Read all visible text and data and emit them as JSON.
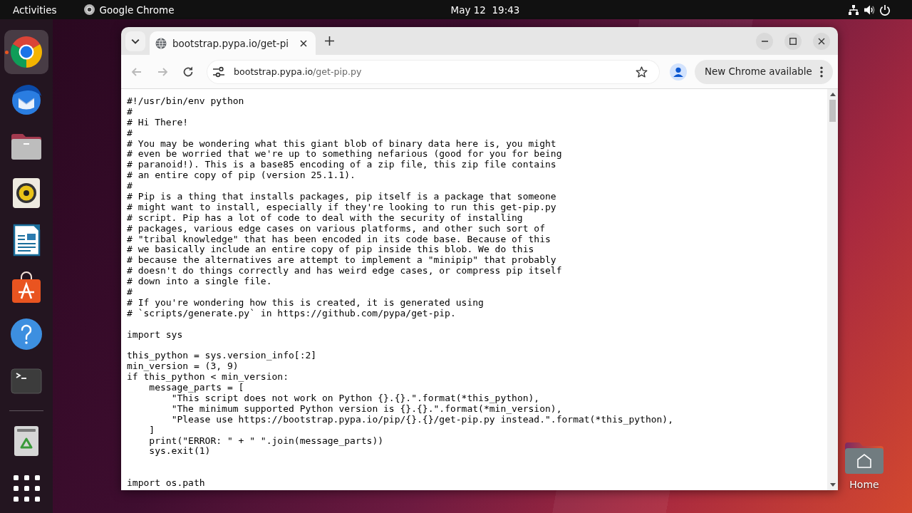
{
  "top_bar": {
    "activities": "Activities",
    "app_menu": "Google Chrome",
    "clock": "May 12  19:43"
  },
  "dock": {
    "apps": [
      {
        "kind": "chrome",
        "running": true,
        "selected": true
      },
      {
        "kind": "thunderbird",
        "running": false,
        "selected": false
      },
      {
        "kind": "files",
        "running": false,
        "selected": false
      },
      {
        "kind": "rhythmbox",
        "running": false,
        "selected": false
      },
      {
        "kind": "writer",
        "running": false,
        "selected": false
      },
      {
        "kind": "app-center",
        "running": false,
        "selected": false
      },
      {
        "kind": "help",
        "running": false,
        "selected": false
      },
      {
        "kind": "terminal",
        "running": false,
        "selected": false
      }
    ],
    "bottom": [
      {
        "kind": "trash"
      },
      {
        "kind": "show-apps"
      }
    ]
  },
  "desktop_icons": [
    {
      "kind": "home-folder",
      "label": "Home"
    }
  ],
  "browser": {
    "tabs": [
      {
        "title": "bootstrap.pypa.io/get-pi",
        "selected": true
      }
    ],
    "toolbar": {
      "nav": [
        {
          "kind": "back",
          "disabled": true
        },
        {
          "kind": "forward",
          "disabled": true
        },
        {
          "kind": "reload",
          "disabled": false
        }
      ],
      "address": {
        "host": "bootstrap.pypa.io",
        "path": "/get-pip.py"
      },
      "update_button": "New Chrome available"
    },
    "page": {
      "lines": [
        {
          "kind": "code",
          "text": "#!/usr/bin/env python"
        },
        {
          "kind": "code",
          "text": "#"
        },
        {
          "kind": "code",
          "text": "# Hi There!"
        },
        {
          "kind": "code",
          "text": "#"
        },
        {
          "kind": "code",
          "text": "# You may be wondering what this giant blob of binary data here is, you might"
        },
        {
          "kind": "code",
          "text": "# even be worried that we're up to something nefarious (good for you for being"
        },
        {
          "kind": "code",
          "text": "# paranoid!). This is a base85 encoding of a zip file, this zip file contains"
        },
        {
          "kind": "code",
          "text": "# an entire copy of pip (version 25.1.1)."
        },
        {
          "kind": "code",
          "text": "#"
        },
        {
          "kind": "code",
          "text": "# Pip is a thing that installs packages, pip itself is a package that someone"
        },
        {
          "kind": "code",
          "text": "# might want to install, especially if they're looking to run this get-pip.py"
        },
        {
          "kind": "code",
          "text": "# script. Pip has a lot of code to deal with the security of installing"
        },
        {
          "kind": "code",
          "text": "# packages, various edge cases on various platforms, and other such sort of"
        },
        {
          "kind": "code",
          "text": "# \"tribal knowledge\" that has been encoded in its code base. Because of this"
        },
        {
          "kind": "code",
          "text": "# we basically include an entire copy of pip inside this blob. We do this"
        },
        {
          "kind": "code",
          "text": "# because the alternatives are attempt to implement a \"minipip\" that probably"
        },
        {
          "kind": "code",
          "text": "# doesn't do things correctly and has weird edge cases, or compress pip itself"
        },
        {
          "kind": "code",
          "text": "# down into a single file."
        },
        {
          "kind": "code",
          "text": "#"
        },
        {
          "kind": "code",
          "text": "# If you're wondering how this is created, it is generated using"
        },
        {
          "kind": "code",
          "text": "# `scripts/generate.py` in https://github.com/pypa/get-pip."
        },
        {
          "kind": "blank"
        },
        {
          "kind": "code",
          "text": "import sys"
        },
        {
          "kind": "blank"
        },
        {
          "kind": "code",
          "text": "this_python = sys.version_info[:2]"
        },
        {
          "kind": "code",
          "text": "min_version = (3, 9)"
        },
        {
          "kind": "code",
          "text": "if this_python < min_version:"
        },
        {
          "kind": "code",
          "text": "    message_parts = ["
        },
        {
          "kind": "code",
          "text": "        \"This script does not work on Python {}.{}.\".format(*this_python),"
        },
        {
          "kind": "code",
          "text": "        \"The minimum supported Python version is {}.{}.\".format(*min_version),"
        },
        {
          "kind": "code",
          "text": "        \"Please use https://bootstrap.pypa.io/pip/{}.{}/get-pip.py instead.\".format(*this_python),"
        },
        {
          "kind": "code",
          "text": "    ]"
        },
        {
          "kind": "code",
          "text": "    print(\"ERROR: \" + \" \".join(message_parts))"
        },
        {
          "kind": "code",
          "text": "    sys.exit(1)"
        },
        {
          "kind": "blank"
        },
        {
          "kind": "blank"
        },
        {
          "kind": "code",
          "text": "import os.path"
        }
      ]
    }
  }
}
